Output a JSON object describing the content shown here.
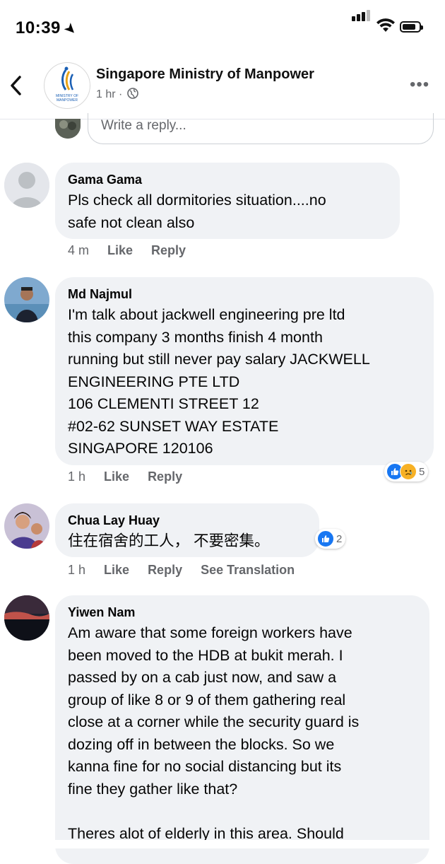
{
  "status_bar": {
    "time": "10:39"
  },
  "header": {
    "page_name": "Singapore Ministry of Manpower",
    "post_time": "1 hr ·",
    "logo_text": "MINISTRY OF MANPOWER"
  },
  "reply_box": {
    "placeholder": "Write a reply..."
  },
  "comments": [
    {
      "author": "Gama Gama",
      "text": "Pls  check all dormitories  situation....no\nsafe not clean also",
      "time": "4 m",
      "like": "Like",
      "reply": "Reply"
    },
    {
      "author": "Md Najmul",
      "text": "I'm talk about  jackwell engineering pre ltd\nthis company 3 months finish 4 month\nrunning but still never pay salary JACKWELL\nENGINEERING PTE LTD\n106 CLEMENTI STREET 12\n#02-62 SUNSET WAY ESTATE\nSINGAPORE 120106",
      "time": "1 h",
      "like": "Like",
      "reply": "Reply",
      "reaction_count": "5"
    },
    {
      "author": "Chua Lay Huay",
      "text": "住在宿舍的工人，  不要密集。",
      "time": "1 h",
      "like": "Like",
      "reply": "Reply",
      "see_translation": "See Translation",
      "reaction_count": "2"
    },
    {
      "author": "Yiwen Nam",
      "text": "Am aware that some foreign workers have\nbeen moved to the HDB at bukit merah. I\npassed by on a cab just now, and saw a\ngroup of like 8 or 9 of them gathering real\nclose at a corner while the security guard is\ndozing off in between the blocks. So we\nkanna fine for no social distancing but its\nfine they gather like that?\n\nTheres alot of elderly in this area. Should"
    }
  ],
  "colors": {
    "accent": "#1877f2",
    "bubble": "#f0f2f5",
    "secondary_text": "#65676b",
    "sad": "#f7b125"
  }
}
